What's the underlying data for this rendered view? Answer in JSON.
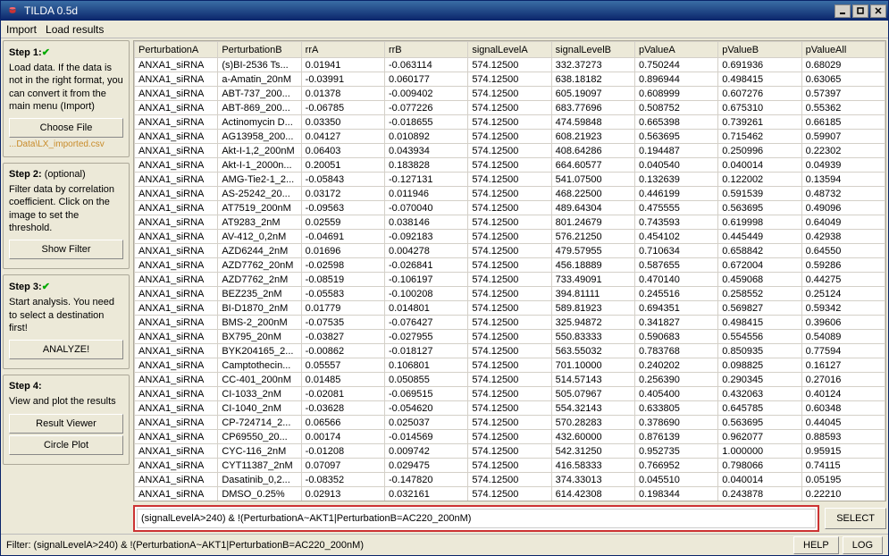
{
  "window": {
    "title": "TILDA 0.5d"
  },
  "menu": {
    "import": "Import",
    "load_results": "Load results"
  },
  "sidebar": {
    "step1": {
      "title": "Step 1:",
      "desc": "Load data. If the data is not in the right format, you can convert it from the main menu (Import)",
      "choose_file": "Choose File",
      "file_path": "...Data\\LX_imported.csv"
    },
    "step2": {
      "title": "Step 2:",
      "optional": "(optional)",
      "desc": "Filter data by correlation coefficient. Click on the image to set the threshold.",
      "show_filter": "Show Filter"
    },
    "step3": {
      "title": "Step 3:",
      "desc": "Start analysis. You need to select a destination first!",
      "analyze": "ANALYZE!"
    },
    "step4": {
      "title": "Step 4:",
      "desc": "View and plot the results",
      "result_viewer": "Result Viewer",
      "circle_plot": "Circle Plot"
    }
  },
  "table": {
    "headers": [
      "PerturbationA",
      "PerturbationB",
      "rrA",
      "rrB",
      "signalLevelA",
      "signalLevelB",
      "pValueA",
      "pValueB",
      "pValueAll"
    ],
    "rows": [
      [
        "ANXA1_siRNA",
        "(s)BI-2536 Ts...",
        "0.01941",
        "-0.063114",
        "574.12500",
        "332.37273",
        "0.750244",
        "0.691936",
        "0.68029"
      ],
      [
        "ANXA1_siRNA",
        "a-Amatin_20nM",
        "-0.03991",
        "0.060177",
        "574.12500",
        "638.18182",
        "0.896944",
        "0.498415",
        "0.63065"
      ],
      [
        "ANXA1_siRNA",
        "ABT-737_200...",
        "0.01378",
        "-0.009402",
        "574.12500",
        "605.19097",
        "0.608999",
        "0.607276",
        "0.57397"
      ],
      [
        "ANXA1_siRNA",
        "ABT-869_200...",
        "-0.06785",
        "-0.077226",
        "574.12500",
        "683.77696",
        "0.508752",
        "0.675310",
        "0.55362"
      ],
      [
        "ANXA1_siRNA",
        "Actinomycin D...",
        "0.03350",
        "-0.018655",
        "574.12500",
        "474.59848",
        "0.665398",
        "0.739261",
        "0.66185"
      ],
      [
        "ANXA1_siRNA",
        "AG13958_200...",
        "0.04127",
        "0.010892",
        "574.12500",
        "608.21923",
        "0.563695",
        "0.715462",
        "0.59907"
      ],
      [
        "ANXA1_siRNA",
        "Akt-I-1,2_200nM",
        "0.06403",
        "0.043934",
        "574.12500",
        "408.64286",
        "0.194487",
        "0.250996",
        "0.22302"
      ],
      [
        "ANXA1_siRNA",
        "Akt-I-1_2000n...",
        "0.20051",
        "0.183828",
        "574.12500",
        "664.60577",
        "0.040540",
        "0.040014",
        "0.04939"
      ],
      [
        "ANXA1_siRNA",
        "AMG-Tie2-1_2...",
        "-0.05843",
        "-0.127131",
        "574.12500",
        "541.07500",
        "0.132639",
        "0.122002",
        "0.13594"
      ],
      [
        "ANXA1_siRNA",
        "AS-25242_20...",
        "0.03172",
        "0.011946",
        "574.12500",
        "468.22500",
        "0.446199",
        "0.591539",
        "0.48732"
      ],
      [
        "ANXA1_siRNA",
        "AT7519_200nM",
        "-0.09563",
        "-0.070040",
        "574.12500",
        "489.64304",
        "0.475555",
        "0.563695",
        "0.49096"
      ],
      [
        "ANXA1_siRNA",
        "AT9283_2nM",
        "0.02559",
        "0.038146",
        "574.12500",
        "801.24679",
        "0.743593",
        "0.619998",
        "0.64049"
      ],
      [
        "ANXA1_siRNA",
        "AV-412_0,2nM",
        "-0.04691",
        "-0.092183",
        "574.12500",
        "576.21250",
        "0.454102",
        "0.445449",
        "0.42938"
      ],
      [
        "ANXA1_siRNA",
        "AZD6244_2nM",
        "0.01696",
        "0.004278",
        "574.12500",
        "479.57955",
        "0.710634",
        "0.658842",
        "0.64550"
      ],
      [
        "ANXA1_siRNA",
        "AZD7762_20nM",
        "-0.02598",
        "-0.026841",
        "574.12500",
        "456.18889",
        "0.587655",
        "0.672004",
        "0.59286"
      ],
      [
        "ANXA1_siRNA",
        "AZD7762_2nM",
        "-0.08519",
        "-0.106197",
        "574.12500",
        "733.49091",
        "0.470140",
        "0.459068",
        "0.44275"
      ],
      [
        "ANXA1_siRNA",
        "BEZ235_2nM",
        "-0.05583",
        "-0.100208",
        "574.12500",
        "394.81111",
        "0.245516",
        "0.258552",
        "0.25124"
      ],
      [
        "ANXA1_siRNA",
        "BI-D1870_2nM",
        "0.01779",
        "0.014801",
        "574.12500",
        "589.81923",
        "0.694351",
        "0.569827",
        "0.59342"
      ],
      [
        "ANXA1_siRNA",
        "BMS-2_200nM",
        "-0.07535",
        "-0.076427",
        "574.12500",
        "325.94872",
        "0.341827",
        "0.498415",
        "0.39606"
      ],
      [
        "ANXA1_siRNA",
        "BX795_20nM",
        "-0.03827",
        "-0.027955",
        "574.12500",
        "550.83333",
        "0.590683",
        "0.554556",
        "0.54089"
      ],
      [
        "ANXA1_siRNA",
        "BYK204165_2...",
        "-0.00862",
        "-0.018127",
        "574.12500",
        "563.55032",
        "0.783768",
        "0.850935",
        "0.77594"
      ],
      [
        "ANXA1_siRNA",
        "Camptothecin...",
        "0.05557",
        "0.106801",
        "574.12500",
        "701.10000",
        "0.240202",
        "0.098825",
        "0.16127"
      ],
      [
        "ANXA1_siRNA",
        "CC-401_200nM",
        "0.01485",
        "0.050855",
        "574.12500",
        "514.57143",
        "0.256390",
        "0.290345",
        "0.27016"
      ],
      [
        "ANXA1_siRNA",
        "CI-1033_2nM",
        "-0.02081",
        "-0.069515",
        "574.12500",
        "505.07967",
        "0.405400",
        "0.432063",
        "0.40124"
      ],
      [
        "ANXA1_siRNA",
        "CI-1040_2nM",
        "-0.03628",
        "-0.054620",
        "574.12500",
        "554.32143",
        "0.633805",
        "0.645785",
        "0.60348"
      ],
      [
        "ANXA1_siRNA",
        "CP-724714_2...",
        "0.06566",
        "0.025037",
        "574.12500",
        "570.28283",
        "0.378690",
        "0.563695",
        "0.44045"
      ],
      [
        "ANXA1_siRNA",
        "CP69550_20...",
        "0.00174",
        "-0.014569",
        "574.12500",
        "432.60000",
        "0.876139",
        "0.962077",
        "0.88593"
      ],
      [
        "ANXA1_siRNA",
        "CYC-116_2nM",
        "-0.01208",
        "0.009742",
        "574.12500",
        "542.31250",
        "0.952735",
        "1.000000",
        "0.95915"
      ],
      [
        "ANXA1_siRNA",
        "CYT11387_2nM",
        "0.07097",
        "0.029475",
        "574.12500",
        "416.58333",
        "0.766952",
        "0.798066",
        "0.74115"
      ],
      [
        "ANXA1_siRNA",
        "Dasatinib_0,2...",
        "-0.08352",
        "-0.147820",
        "574.12500",
        "374.33013",
        "0.045510",
        "0.040014",
        "0.05195"
      ],
      [
        "ANXA1_siRNA",
        "DMSO_0.25%",
        "0.02913",
        "0.032161",
        "574.12500",
        "614.42308",
        "0.198344",
        "0.243878",
        "0.22210"
      ]
    ]
  },
  "filter": {
    "input_value": "(signalLevelA>240) & !(PerturbationA~AKT1|PerturbationB=AC220_200nM)",
    "select_label": "SELECT"
  },
  "statusbar": {
    "text": "Filter: (signalLevelA>240) & !(PerturbationA~AKT1|PerturbationB=AC220_200nM)",
    "help": "HELP",
    "log": "LOG"
  }
}
